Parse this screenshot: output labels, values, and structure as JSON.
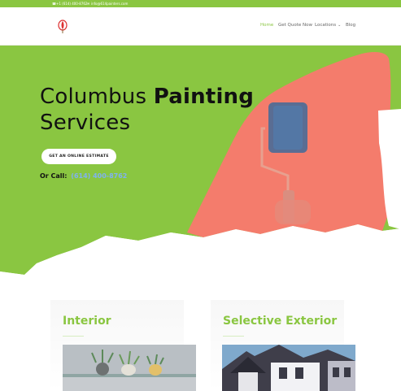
{
  "topbar": {
    "phone": "+1 (614) 400-8762",
    "email": "info@614painters.com"
  },
  "nav": {
    "items": [
      {
        "label": "Home",
        "active": true
      },
      {
        "label": "Get Quote Now",
        "active": false
      },
      {
        "label": "Locations",
        "active": false,
        "has_dropdown": true
      },
      {
        "label": "Blog",
        "active": false
      }
    ]
  },
  "hero": {
    "title_regular_1": "Columbus ",
    "title_bold": "Painting",
    "title_regular_2": "Services",
    "cta_label": "GET AN ONLINE ESTIMATE",
    "call_label": "Or Call:",
    "call_number": "(614) 400-8762"
  },
  "cards": [
    {
      "title": "Interior"
    },
    {
      "title": "Selective Exterior"
    }
  ],
  "colors": {
    "brand_green": "#8ac641",
    "coral": "#f47c6c",
    "link_blue": "#7fb2f0"
  },
  "icons": [
    "phone-icon",
    "email-icon",
    "chevron-down-icon",
    "logo-icon",
    "paint-roller-icon"
  ]
}
